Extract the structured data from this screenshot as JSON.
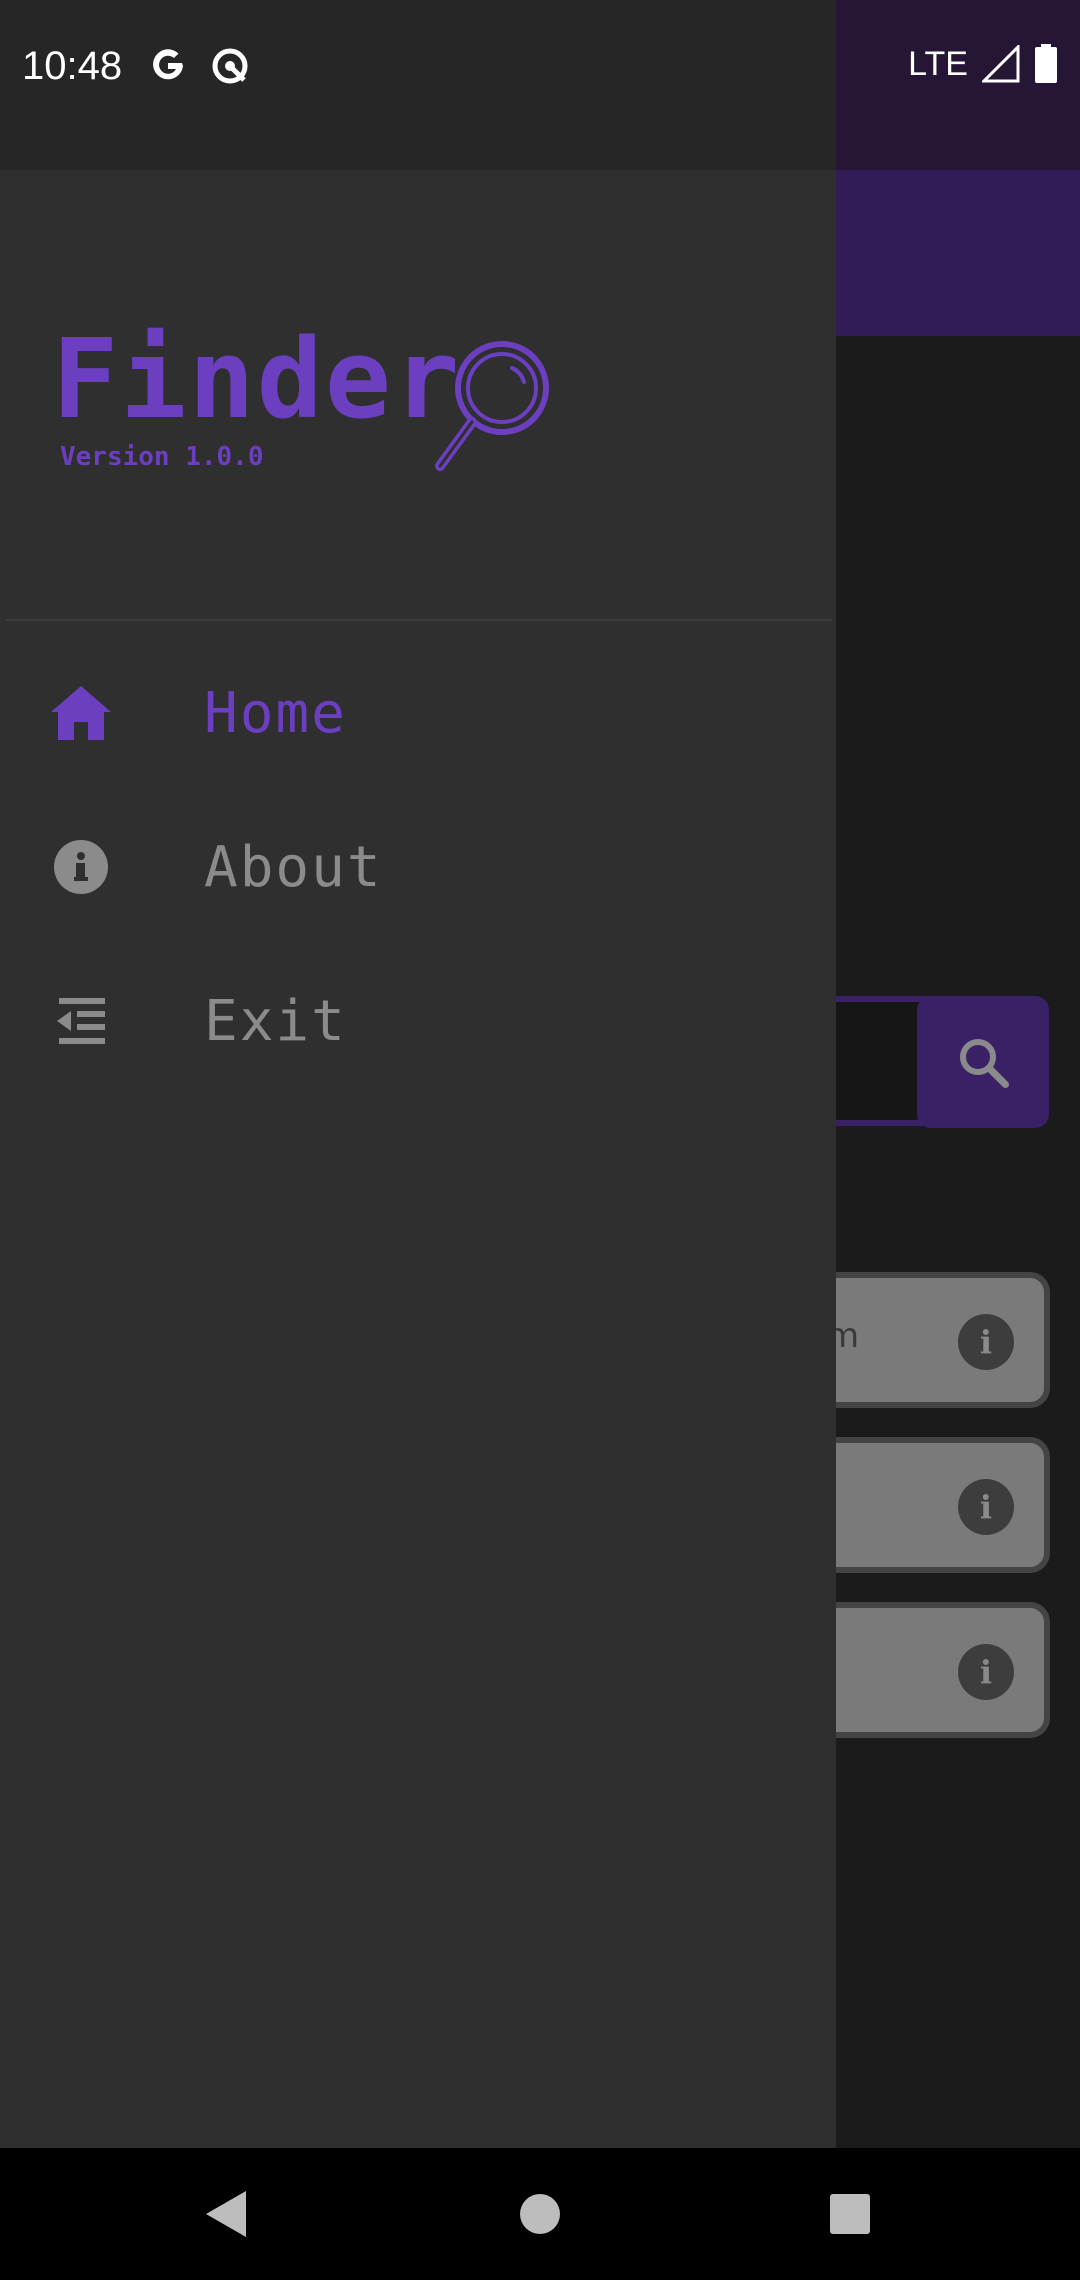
{
  "status_bar": {
    "time": "10:48",
    "network": "LTE",
    "left_icons": [
      "google-icon",
      "data-saver-icon"
    ],
    "right_icons": [
      "signal-icon",
      "battery-icon"
    ]
  },
  "drawer": {
    "app_name": "Finder",
    "version": "Version 1.0.0",
    "menu": [
      {
        "label": "Home",
        "icon": "home-icon",
        "active": true
      },
      {
        "label": "About",
        "icon": "info-icon",
        "active": false
      },
      {
        "label": "Exit",
        "icon": "exit-icon",
        "active": false
      }
    ]
  },
  "background": {
    "card_partial_text": "m",
    "info_glyph": "i"
  },
  "colors": {
    "accent": "#6b3fc0",
    "drawer_bg": "#2f2f2f",
    "menu_text_inactive": "#8b8b8b"
  },
  "nav_bar": [
    "back-icon",
    "home-circle-icon",
    "recents-icon"
  ]
}
